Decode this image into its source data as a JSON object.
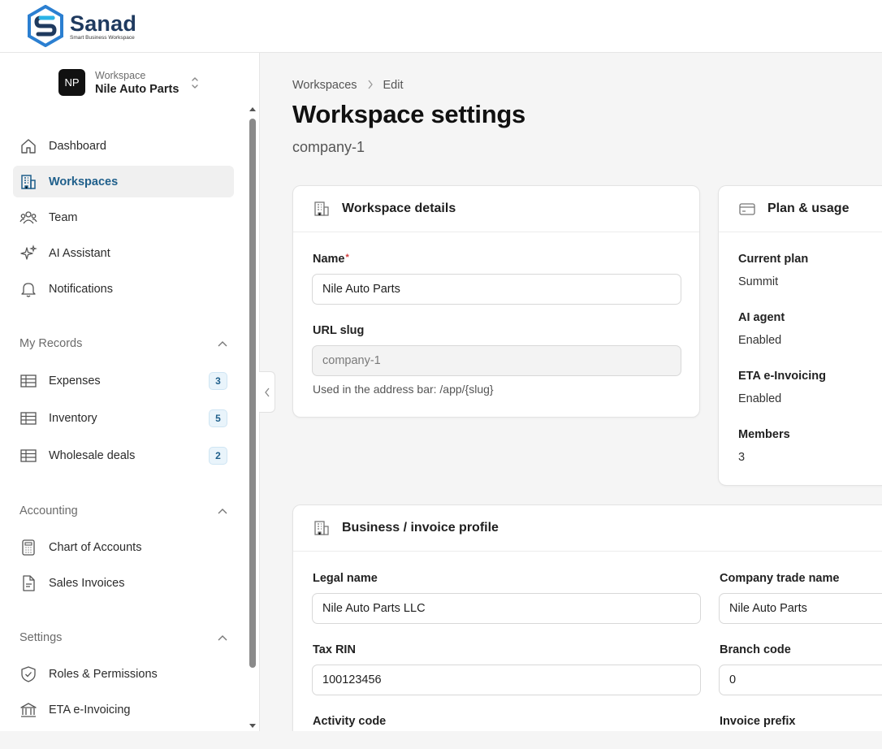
{
  "brand": {
    "name": "Sanad",
    "tagline": "Smart Business Workspace",
    "colors": {
      "primary": "#1f3a5f",
      "accent_blue": "#2b7fd1",
      "accent_cyan": "#2bb3e6"
    }
  },
  "workspace_switcher": {
    "avatar_initials": "NP",
    "caption": "Workspace",
    "name": "Nile Auto Parts"
  },
  "nav": {
    "main": [
      {
        "label": "Dashboard",
        "icon": "home-icon"
      },
      {
        "label": "Workspaces",
        "icon": "building-icon",
        "active": true
      },
      {
        "label": "Team",
        "icon": "users-icon"
      },
      {
        "label": "AI Assistant",
        "icon": "sparkles-icon"
      },
      {
        "label": "Notifications",
        "icon": "bell-icon"
      }
    ],
    "sections": [
      {
        "title": "My Records",
        "items": [
          {
            "label": "Expenses",
            "icon": "table-icon",
            "badge": "3"
          },
          {
            "label": "Inventory",
            "icon": "table-icon",
            "badge": "5"
          },
          {
            "label": "Wholesale deals",
            "icon": "table-icon",
            "badge": "2"
          }
        ]
      },
      {
        "title": "Accounting",
        "items": [
          {
            "label": "Chart of Accounts",
            "icon": "calculator-icon"
          },
          {
            "label": "Sales Invoices",
            "icon": "file-icon"
          }
        ]
      },
      {
        "title": "Settings",
        "items": [
          {
            "label": "Roles & Permissions",
            "icon": "shield-icon"
          },
          {
            "label": "ETA e-Invoicing",
            "icon": "bank-icon"
          }
        ]
      }
    ]
  },
  "breadcrumb": {
    "parent": "Workspaces",
    "current": "Edit"
  },
  "page": {
    "title": "Workspace settings",
    "subtitle": "company-1"
  },
  "workspace_details": {
    "title": "Workspace details",
    "name_label": "Name",
    "name_value": "Nile Auto Parts",
    "slug_label": "URL slug",
    "slug_value": "company-1",
    "slug_hint": "Used in the address bar: /app/{slug}"
  },
  "plan_usage": {
    "title": "Plan & usage",
    "items": [
      {
        "label": "Current plan",
        "value": "Summit"
      },
      {
        "label": "AI agent",
        "value": "Enabled"
      },
      {
        "label": "ETA e-Invoicing",
        "value": "Enabled"
      },
      {
        "label": "Members",
        "value": "3"
      }
    ]
  },
  "business_profile": {
    "title": "Business / invoice profile",
    "legal_name_label": "Legal name",
    "legal_name_value": "Nile Auto Parts LLC",
    "trade_name_label": "Company trade name",
    "trade_name_value": "Nile Auto Parts",
    "tax_rin_label": "Tax RIN",
    "tax_rin_value": "100123456",
    "branch_code_label": "Branch code",
    "branch_code_value": "0",
    "activity_code_label": "Activity code",
    "invoice_prefix_label": "Invoice prefix"
  }
}
